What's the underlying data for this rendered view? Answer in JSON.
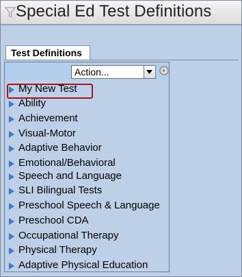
{
  "window": {
    "title": "Special Ed Test Definitions",
    "title_icon": "funnel-icon"
  },
  "tab": {
    "label": "Test Definitions"
  },
  "toolbar": {
    "action_value": "Action...",
    "go_icon": "go-circle-icon"
  },
  "tree": {
    "items": [
      {
        "label": "My New Test",
        "selected": true
      },
      {
        "label": "Ability"
      },
      {
        "label": "Achievement"
      },
      {
        "label": "Visual-Motor"
      },
      {
        "label": "Adaptive Behavior"
      },
      {
        "label": "Emotional/Behavioral"
      },
      {
        "label": "Speech and Language"
      },
      {
        "label": "SLI Bilingual Tests"
      },
      {
        "label": "Preschool Speech & Language"
      },
      {
        "label": "Preschool CDA"
      },
      {
        "label": "Occupational Therapy"
      },
      {
        "label": "Physical Therapy"
      },
      {
        "label": "Adaptive Physical Education"
      }
    ]
  },
  "colors": {
    "highlight": "#a51521",
    "arrow": "#3f79c6",
    "panel": "#bdd0e8"
  }
}
